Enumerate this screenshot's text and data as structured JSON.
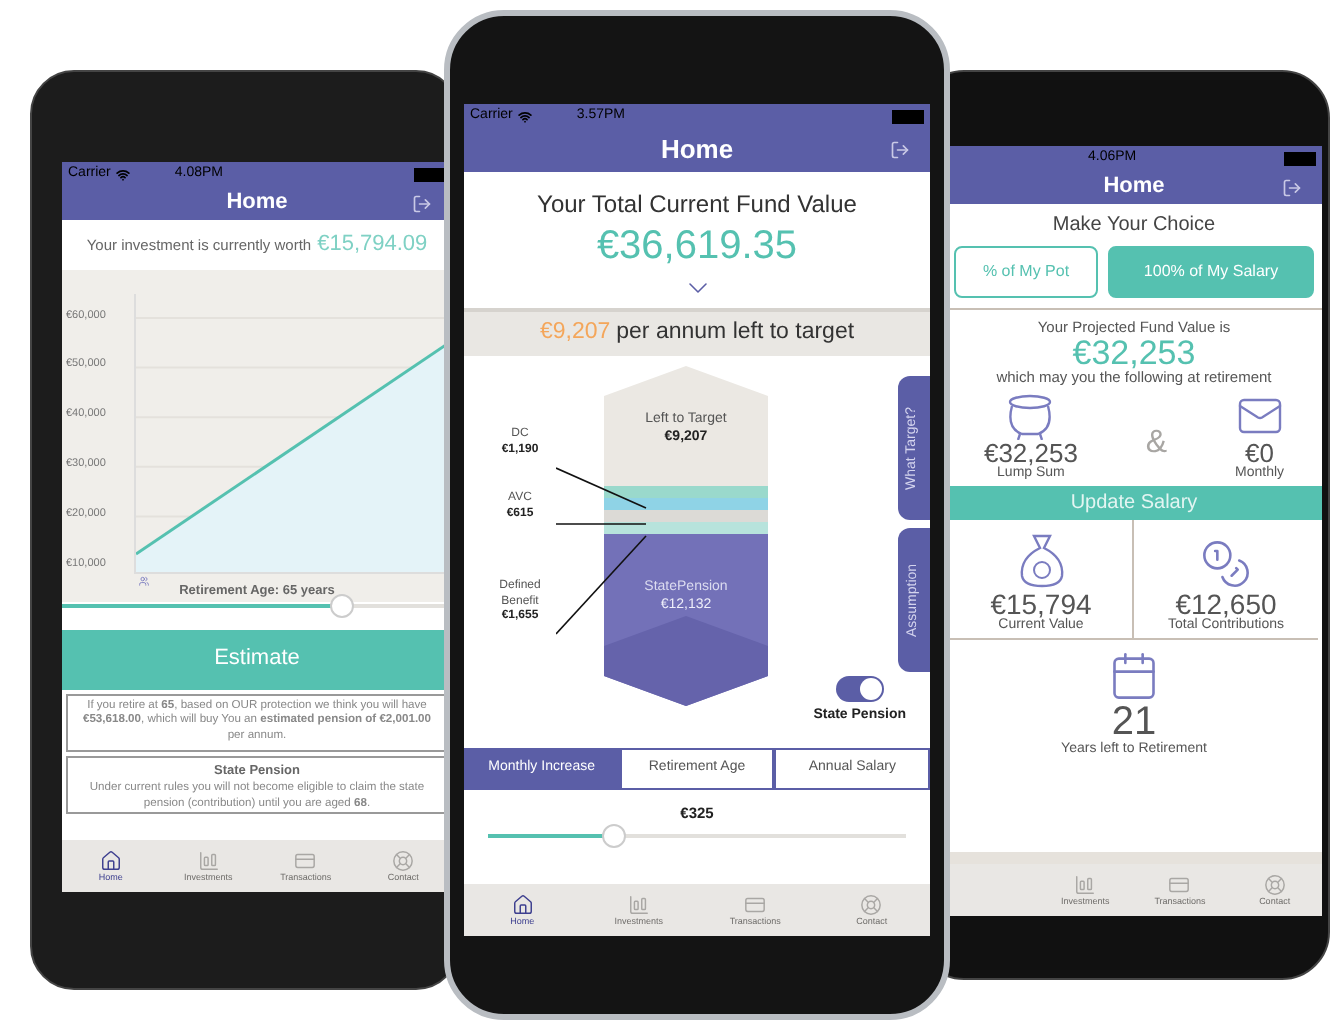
{
  "left_phone": {
    "status_bar": {
      "carrier": "Carrier",
      "time": "4.08PM"
    },
    "nav_title": "Home",
    "worth_label": "Your investment is currently worth",
    "worth_value": "€15,794.09",
    "y_axis_labels": [
      "€60,000",
      "€50,000",
      "€40,000",
      "€30,000",
      "€20,000",
      "€10,000"
    ],
    "retirement_age": "Retirement Age: 65 years",
    "age_slider": {
      "level": 0.72
    },
    "estimate_button": "Estimate",
    "estimate_text": "If you retire at **65**, based on OUR protection we think you will have **€53,618.00**, which will buy You an **estimated pension of €2,001.00** per annum.",
    "state_pension": {
      "title": "State Pension",
      "text": "Under current rules you will not become eligible to claim the state pension (contribution) until you are aged **68**."
    },
    "tab_bar": [
      {
        "kind": "home",
        "label": "Home",
        "selected": true
      },
      {
        "kind": "investments",
        "label": "Investments",
        "selected": false
      },
      {
        "kind": "transactions",
        "label": "Transactions",
        "selected": false
      },
      {
        "kind": "contact",
        "label": "Contact",
        "selected": false
      }
    ]
  },
  "center_phone": {
    "status_bar": {
      "carrier": "Carrier",
      "time": "3.57PM"
    },
    "nav_title": "Home",
    "fund_title": "Your Total Current Fund Value",
    "fund_value": "€36,619.35",
    "target_amount": "€9,207",
    "target_text": "per annum left to target",
    "stack": {
      "top_label": "Left to Target",
      "top_value": "€9,207",
      "bottom_label": "StatePension",
      "bottom_value": "€12,132"
    },
    "callouts": [
      {
        "label": "DC",
        "value": "€1,190"
      },
      {
        "label": "AVC",
        "value": "€615"
      },
      {
        "label": "Defined Benefit",
        "value": "€1,655"
      }
    ],
    "side_tabs": [
      "What Target?",
      "Assumption"
    ],
    "state_pension_toggle": {
      "label": "State Pension",
      "on": true
    },
    "segments": [
      {
        "label": "Monthly Increase",
        "selected": true
      },
      {
        "label": "Retirement Age",
        "selected": false
      },
      {
        "label": "Annual Salary",
        "selected": false
      }
    ],
    "slider": {
      "reading": "€325",
      "level": 0.3
    },
    "tab_bar": [
      {
        "kind": "home",
        "label": "Home",
        "selected": true
      },
      {
        "kind": "investments",
        "label": "Investments",
        "selected": false
      },
      {
        "kind": "transactions",
        "label": "Transactions",
        "selected": false
      },
      {
        "kind": "contact",
        "label": "Contact",
        "selected": false
      }
    ]
  },
  "right_phone": {
    "status_bar": {
      "time": "4.06PM"
    },
    "nav_title": "Home",
    "choice_title": "Make Your Choice",
    "choices": [
      {
        "label": "% of My Pot",
        "selected": false
      },
      {
        "label": "100% of My Salary",
        "selected": true
      }
    ],
    "projected_label": "Your Projected Fund Value is",
    "projected_value": "€32,253",
    "projected_note": "which may you the following at retirement",
    "lump_sum": {
      "value": "€32,253",
      "label": "Lump Sum"
    },
    "ampersand": "&",
    "monthly": {
      "value": "€0",
      "label": "Monthly"
    },
    "update_button": "Update Salary",
    "stats": [
      {
        "kind": "bag",
        "value": "€15,794",
        "label": "Current Value"
      },
      {
        "kind": "coins",
        "value": "€12,650",
        "label": "Total Contributions"
      },
      {
        "kind": "calendar",
        "value": "21",
        "label": "Years left to Retirement"
      }
    ],
    "tab_bar": [
      {
        "kind": "investments",
        "label": "Investments",
        "selected": false
      },
      {
        "kind": "transactions",
        "label": "Transactions",
        "selected": false
      },
      {
        "kind": "contact",
        "label": "Contact",
        "selected": false
      }
    ]
  }
}
